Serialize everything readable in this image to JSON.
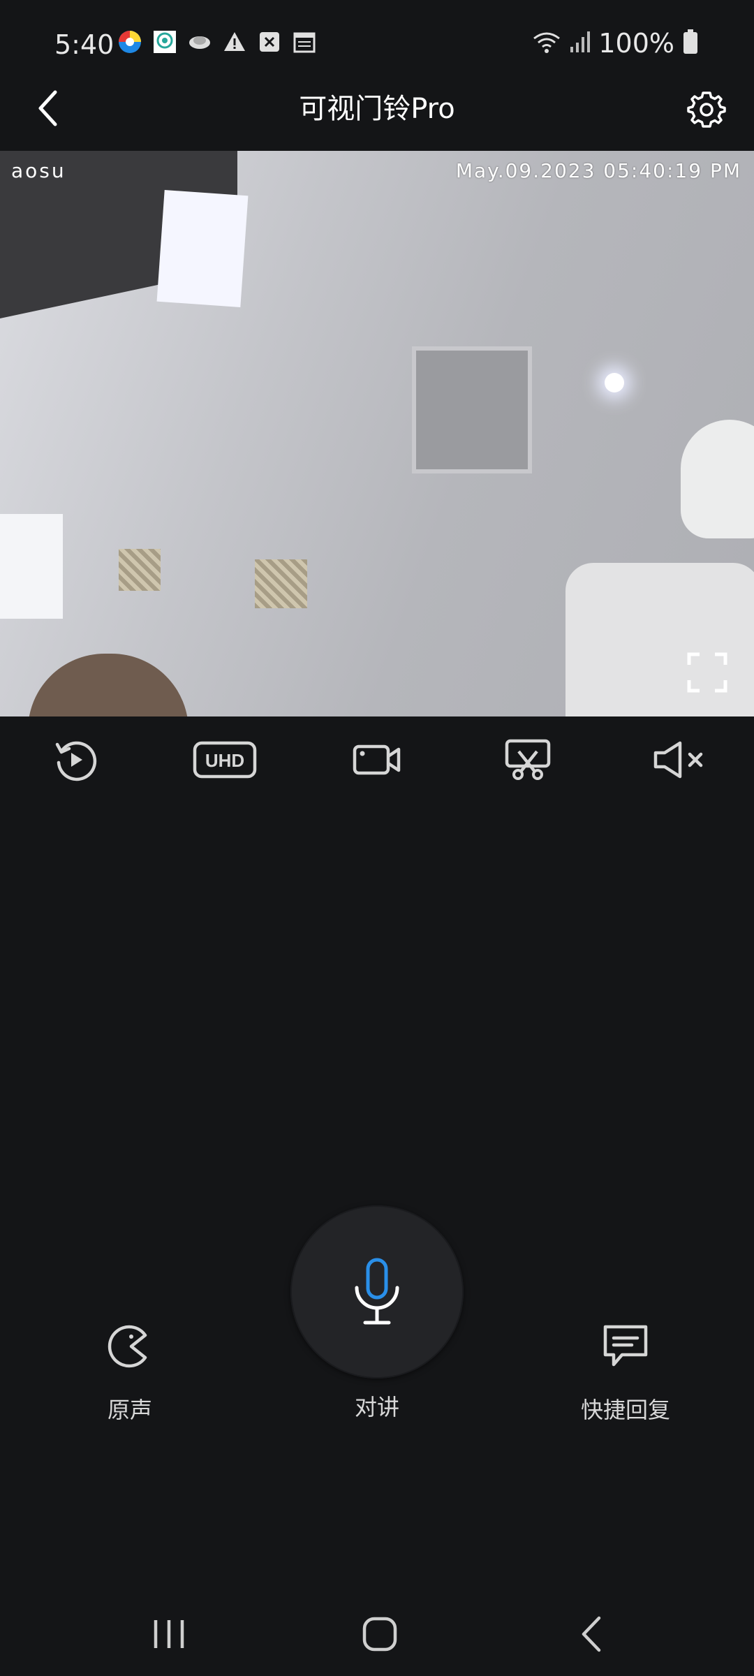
{
  "status_bar": {
    "time": "5:40",
    "battery": "100%",
    "icons": [
      "chrome-like-icon",
      "target-icon",
      "cloud-icon",
      "warning-icon",
      "close-box-icon",
      "calendar-icon",
      "wifi-icon",
      "signal-icon",
      "battery-icon"
    ]
  },
  "header": {
    "title": "可视门铃Pro",
    "back_icon": "chevron-left-icon",
    "settings_icon": "gear-icon"
  },
  "video": {
    "brand": "aosu",
    "timestamp": "May.09.2023 05:40:19 PM",
    "fullscreen_icon": "fullscreen-icon"
  },
  "toolbar": {
    "items": [
      {
        "name": "playback",
        "icon": "history-play-icon"
      },
      {
        "name": "quality",
        "icon": "uhd-icon",
        "label": "UHD"
      },
      {
        "name": "record",
        "icon": "video-camera-icon"
      },
      {
        "name": "screenshot",
        "icon": "scissors-icon"
      },
      {
        "name": "mute",
        "icon": "speaker-mute-icon"
      }
    ]
  },
  "controls": {
    "voice_label": "原声",
    "talk_label": "对讲",
    "quick_reply_label": "快捷回复"
  },
  "colors": {
    "background": "#141517",
    "accent_blue": "#2a8fe8",
    "talk_button": "#232427"
  }
}
